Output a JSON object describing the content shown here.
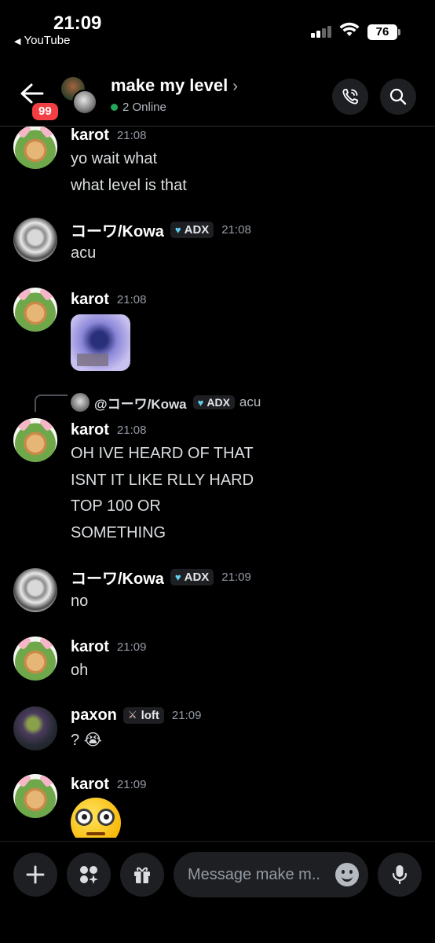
{
  "status_bar": {
    "time": "21:09",
    "back_app": "YouTube",
    "battery": "76"
  },
  "header": {
    "unread_count": "99",
    "channel_title": "make my level",
    "online": "2 Online"
  },
  "messages": [
    {
      "username": "karot",
      "timestamp": "21:08",
      "lines": [
        "yo wait what",
        "what level is that"
      ]
    },
    {
      "username": "コーワ/Kowa",
      "tag": "ADX",
      "timestamp": "21:08",
      "lines": [
        "acu"
      ]
    },
    {
      "username": "karot",
      "timestamp": "21:08",
      "attachment": "image"
    },
    {
      "reply": {
        "mention": "@コーワ/Kowa",
        "tag": "ADX",
        "text": "acu"
      },
      "username": "karot",
      "timestamp": "21:08",
      "lines": [
        "OH IVE HEARD OF THAT",
        "ISNT IT LIKE RLLY HARD",
        "TOP 100 OR",
        "SOMETHING"
      ]
    },
    {
      "username": "コーワ/Kowa",
      "tag": "ADX",
      "timestamp": "21:09",
      "lines": [
        "no"
      ]
    },
    {
      "username": "karot",
      "timestamp": "21:09",
      "lines": [
        "oh"
      ]
    },
    {
      "username": "paxon",
      "tag": "loft",
      "timestamp": "21:09",
      "lines": [
        "? 😭"
      ]
    },
    {
      "username": "karot",
      "timestamp": "21:09",
      "emoji": "face-with-monocle-glasses"
    }
  ],
  "composer": {
    "placeholder": "Message make m.."
  },
  "colors": {
    "online_dot": "#23a55a",
    "unread_badge": "#f23f43",
    "adx_gem": "#5fd0ee"
  }
}
